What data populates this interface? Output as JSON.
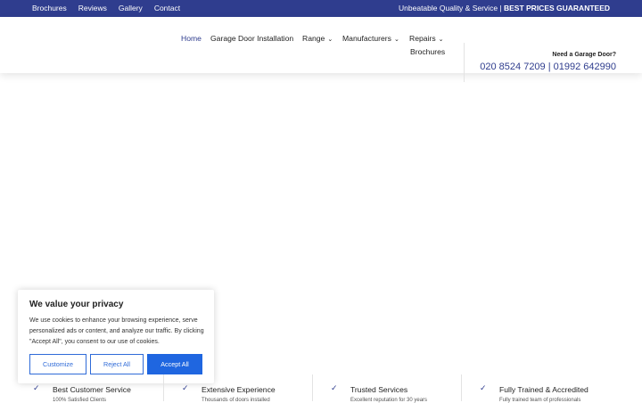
{
  "topbar": {
    "links": [
      "Brochures",
      "Reviews",
      "Gallery",
      "Contact"
    ],
    "tagline_text": "Unbeatable Quality & Service | ",
    "tagline_bold": "BEST PRICES GUARANTEED",
    "bg_color": "#2f3d8e"
  },
  "nav": {
    "home": "Home",
    "installation": "Garage Door Installation",
    "range": "Range",
    "manufacturers": "Manufacturers",
    "repairs": "Repairs",
    "brochures": "Brochures",
    "chevron": "⌄"
  },
  "contact": {
    "label": "Need a Garage Door?",
    "phones": "020 8524 7209 | 01992 642990"
  },
  "cookie": {
    "title": "We value your privacy",
    "body": "We use cookies to enhance your browsing experience, serve personalized ads or content, and analyze our traffic. By clicking \"Accept All\", you consent to our use of cookies.",
    "customize": "Customize",
    "reject": "Reject All",
    "accept": "Accept All",
    "accent_color": "#1f66e0"
  },
  "features": [
    {
      "icon": "check-icon",
      "title": "Best Customer Service",
      "sub": "100% Satisfied Clients"
    },
    {
      "icon": "check-icon",
      "title": "Extensive Experience",
      "sub": "Thousands of doors installed"
    },
    {
      "icon": "check-icon",
      "title": "Trusted Services",
      "sub": "Excellent reputation for 30 years"
    },
    {
      "icon": "check-icon",
      "title": "Fully Trained & Accredited",
      "sub": "Fully trained team of professionals"
    }
  ],
  "check_glyph": "✓"
}
